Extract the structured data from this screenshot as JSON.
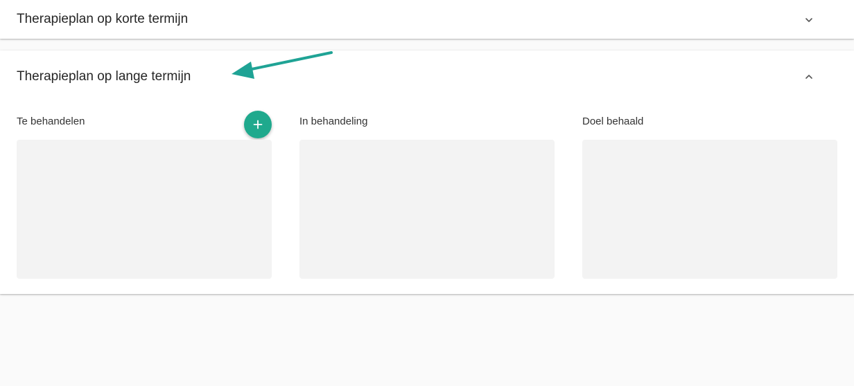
{
  "panels": {
    "short_term": {
      "title": "Therapieplan op korte termijn",
      "expanded": false,
      "toggle_icon": "chevron-down-icon"
    },
    "long_term": {
      "title": "Therapieplan op lange termijn",
      "expanded": true,
      "toggle_icon": "chevron-up-icon",
      "columns": [
        {
          "label": "Te behandelen",
          "has_add_button": true
        },
        {
          "label": "In behandeling",
          "has_add_button": false
        },
        {
          "label": "Doel behaald",
          "has_add_button": false
        }
      ],
      "add_button_icon": "plus-icon"
    }
  },
  "annotation": {
    "icon": "arrow-icon",
    "color": "#1fa395"
  },
  "colors": {
    "accent": "#1fa98d",
    "page_background": "#fafafa",
    "panel_background": "#ffffff",
    "column_background": "#f3f3f3"
  }
}
